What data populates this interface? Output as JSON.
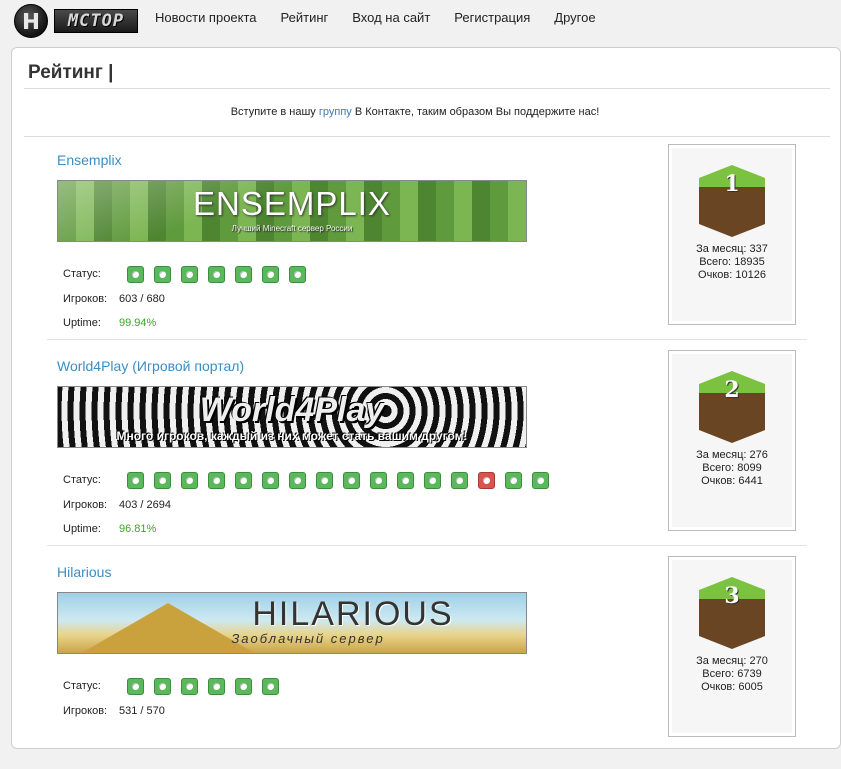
{
  "nav": {
    "logo_text": "MCTOP",
    "items": [
      {
        "label": "Новости проекта"
      },
      {
        "label": "Рейтинг"
      },
      {
        "label": "Вход на сайт"
      },
      {
        "label": "Регистрация"
      },
      {
        "label": "Другое"
      }
    ]
  },
  "page": {
    "title": "Рейтинг |",
    "notice_before": "Вступите в нашу ",
    "notice_link": "группу",
    "notice_after": " В Контакте, таким образом Вы поддержите нас!"
  },
  "labels": {
    "status": "Статус:",
    "players": "Игроков:",
    "uptime": "Uptime:",
    "month": "За месяц:",
    "total": "Всего:",
    "points": "Очков:"
  },
  "servers": [
    {
      "name": "Ensemplix",
      "banner_title": "ENSEMPLIX",
      "banner_subtitle": "Лучший Minecraft сервер России",
      "status_icons": [
        "online",
        "online",
        "online",
        "online",
        "online",
        "online",
        "online"
      ],
      "players": "603 / 680",
      "uptime": "99.94%",
      "rank": "1",
      "month": "337",
      "total": "18935",
      "points": "10126"
    },
    {
      "name": "World4Play (Игровой портал)",
      "banner_title": "World4Play",
      "banner_subtitle": "Много игроков, каждый из них может стать вашим другом!",
      "status_icons": [
        "online",
        "online",
        "online",
        "online",
        "online",
        "online",
        "online",
        "online",
        "online",
        "online",
        "online",
        "online",
        "online",
        "offline",
        "online",
        "online"
      ],
      "players": "403 / 2694",
      "uptime": "96.81%",
      "rank": "2",
      "month": "276",
      "total": "8099",
      "points": "6441"
    },
    {
      "name": "Hilarious",
      "banner_title": "HILARIOUS",
      "banner_subtitle": "Заоблачный сервер",
      "status_icons": [
        "online",
        "online",
        "online",
        "online",
        "online",
        "online"
      ],
      "players": "531 / 570",
      "uptime": "",
      "rank": "3",
      "month": "270",
      "total": "6739",
      "points": "6005"
    }
  ],
  "colors": {
    "link": "#3a8ec2",
    "online": "#5cb85c",
    "offline": "#d9534f",
    "uptime": "#3fa32a"
  }
}
